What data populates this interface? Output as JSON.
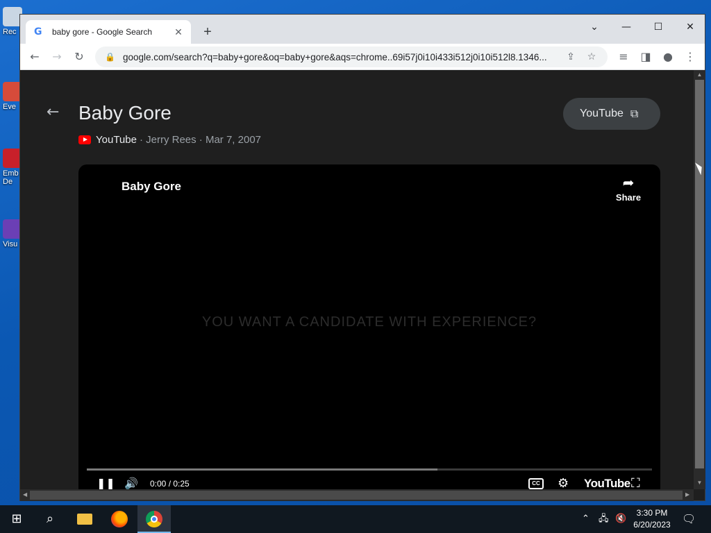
{
  "desktop": {
    "icons": [
      {
        "label": "Rec"
      },
      {
        "label": "Eve"
      },
      {
        "label": "Emb\nDe"
      },
      {
        "label": "Visu"
      }
    ]
  },
  "browser": {
    "tab": {
      "title": "baby gore - Google Search",
      "close": "✕"
    },
    "new_tab": "+",
    "window_controls": {
      "list": "⌄",
      "minimize": "—",
      "maximize": "☐",
      "close": "✕"
    },
    "url": "google.com/search?q=baby+gore&oq=baby+gore&aqs=chrome..69i57j0i10i433i512j0i10i512l8.1346..."
  },
  "result": {
    "title": "Baby Gore",
    "source": "YouTube",
    "meta_rest": "· Jerry Rees · Mar 7, 2007",
    "open_button": "YouTube"
  },
  "player": {
    "title": "Baby Gore",
    "share_label": "Share",
    "caption": "YOU WANT A CANDIDATE WITH EXPERIENCE?",
    "time": "0:00 / 0:25",
    "progress": 0.62,
    "cc_label": "CC",
    "brand": "YouTube"
  },
  "taskbar": {
    "time": "3:30 PM",
    "date": "6/20/2023"
  }
}
